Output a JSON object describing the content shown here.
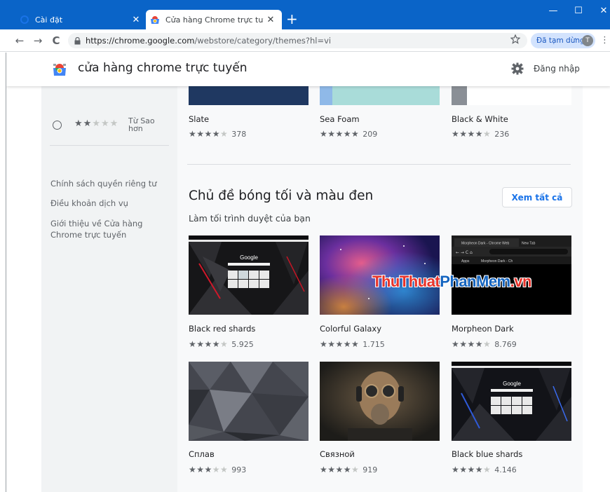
{
  "browser": {
    "tabs": [
      {
        "title": "Cài đặt",
        "active": false,
        "close": "✕"
      },
      {
        "title": "Cửa hàng Chrome trực tuyến - C",
        "active": true,
        "close": "✕"
      }
    ],
    "new_tab": "+",
    "window_controls": {
      "minimize": "—",
      "maximize": "☐",
      "close": "✕"
    },
    "nav": {
      "back": "←",
      "forward": "→",
      "reload": "C"
    },
    "url": {
      "host": "https://chrome.google.com",
      "path": "/webstore/category/themes?hl=vi"
    },
    "bookmark_icon": "star-outline-icon",
    "profile": {
      "label": "Đã tạm dừng",
      "initial": "T"
    },
    "menu": "⋮"
  },
  "store": {
    "title": "cửa hàng chrome trực tuyến",
    "sign_in": "Đăng nhập"
  },
  "sidebar": {
    "rating_filter_more_cut": "Từ Sao",
    "rating_filter_more": "hơn",
    "rating_filter_stars": 2,
    "links": [
      "Chính sách quyền riêng tư",
      "Điều khoản dịch vụ",
      "Giới thiệu về Cửa hàng Chrome trực tuyến"
    ]
  },
  "top_row": [
    {
      "name": "Slate",
      "stars": 4.5,
      "count": "378",
      "color": "#1f3861"
    },
    {
      "name": "Sea Foam",
      "stars": 5,
      "count": "209",
      "color": "#a9dcd9"
    },
    {
      "name": "Black & White",
      "stars": 4.5,
      "count": "236",
      "color": "#ffffff"
    }
  ],
  "section": {
    "title": "Chủ đề bóng tối và màu đen",
    "subtitle": "Làm tối trình duyệt của bạn",
    "see_all": "Xem tất cả"
  },
  "themes": [
    {
      "name": "Black red shards",
      "stars": 4,
      "count": "5.925"
    },
    {
      "name": "Colorful Galaxy",
      "stars": 4.5,
      "count": "1.715"
    },
    {
      "name": "Morpheon Dark",
      "stars": 4.5,
      "count": "8.769"
    },
    {
      "name": "Сплав",
      "stars": 3.5,
      "count": "993"
    },
    {
      "name": "Связной",
      "stars": 4,
      "count": "919"
    },
    {
      "name": "Black blue shards",
      "stars": 4.5,
      "count": "4.146"
    }
  ],
  "morpheon_preview": {
    "tab1": "Morpheon Dark - Chrome Web",
    "tab2": "New Tab",
    "apps": "Apps",
    "bookmark": "Morpheon Dark - Ch"
  },
  "preview_logo": "Google",
  "watermark": {
    "part_a": "ThuThuat",
    "part_b": "PhanMem",
    "part_c": ".vn"
  }
}
